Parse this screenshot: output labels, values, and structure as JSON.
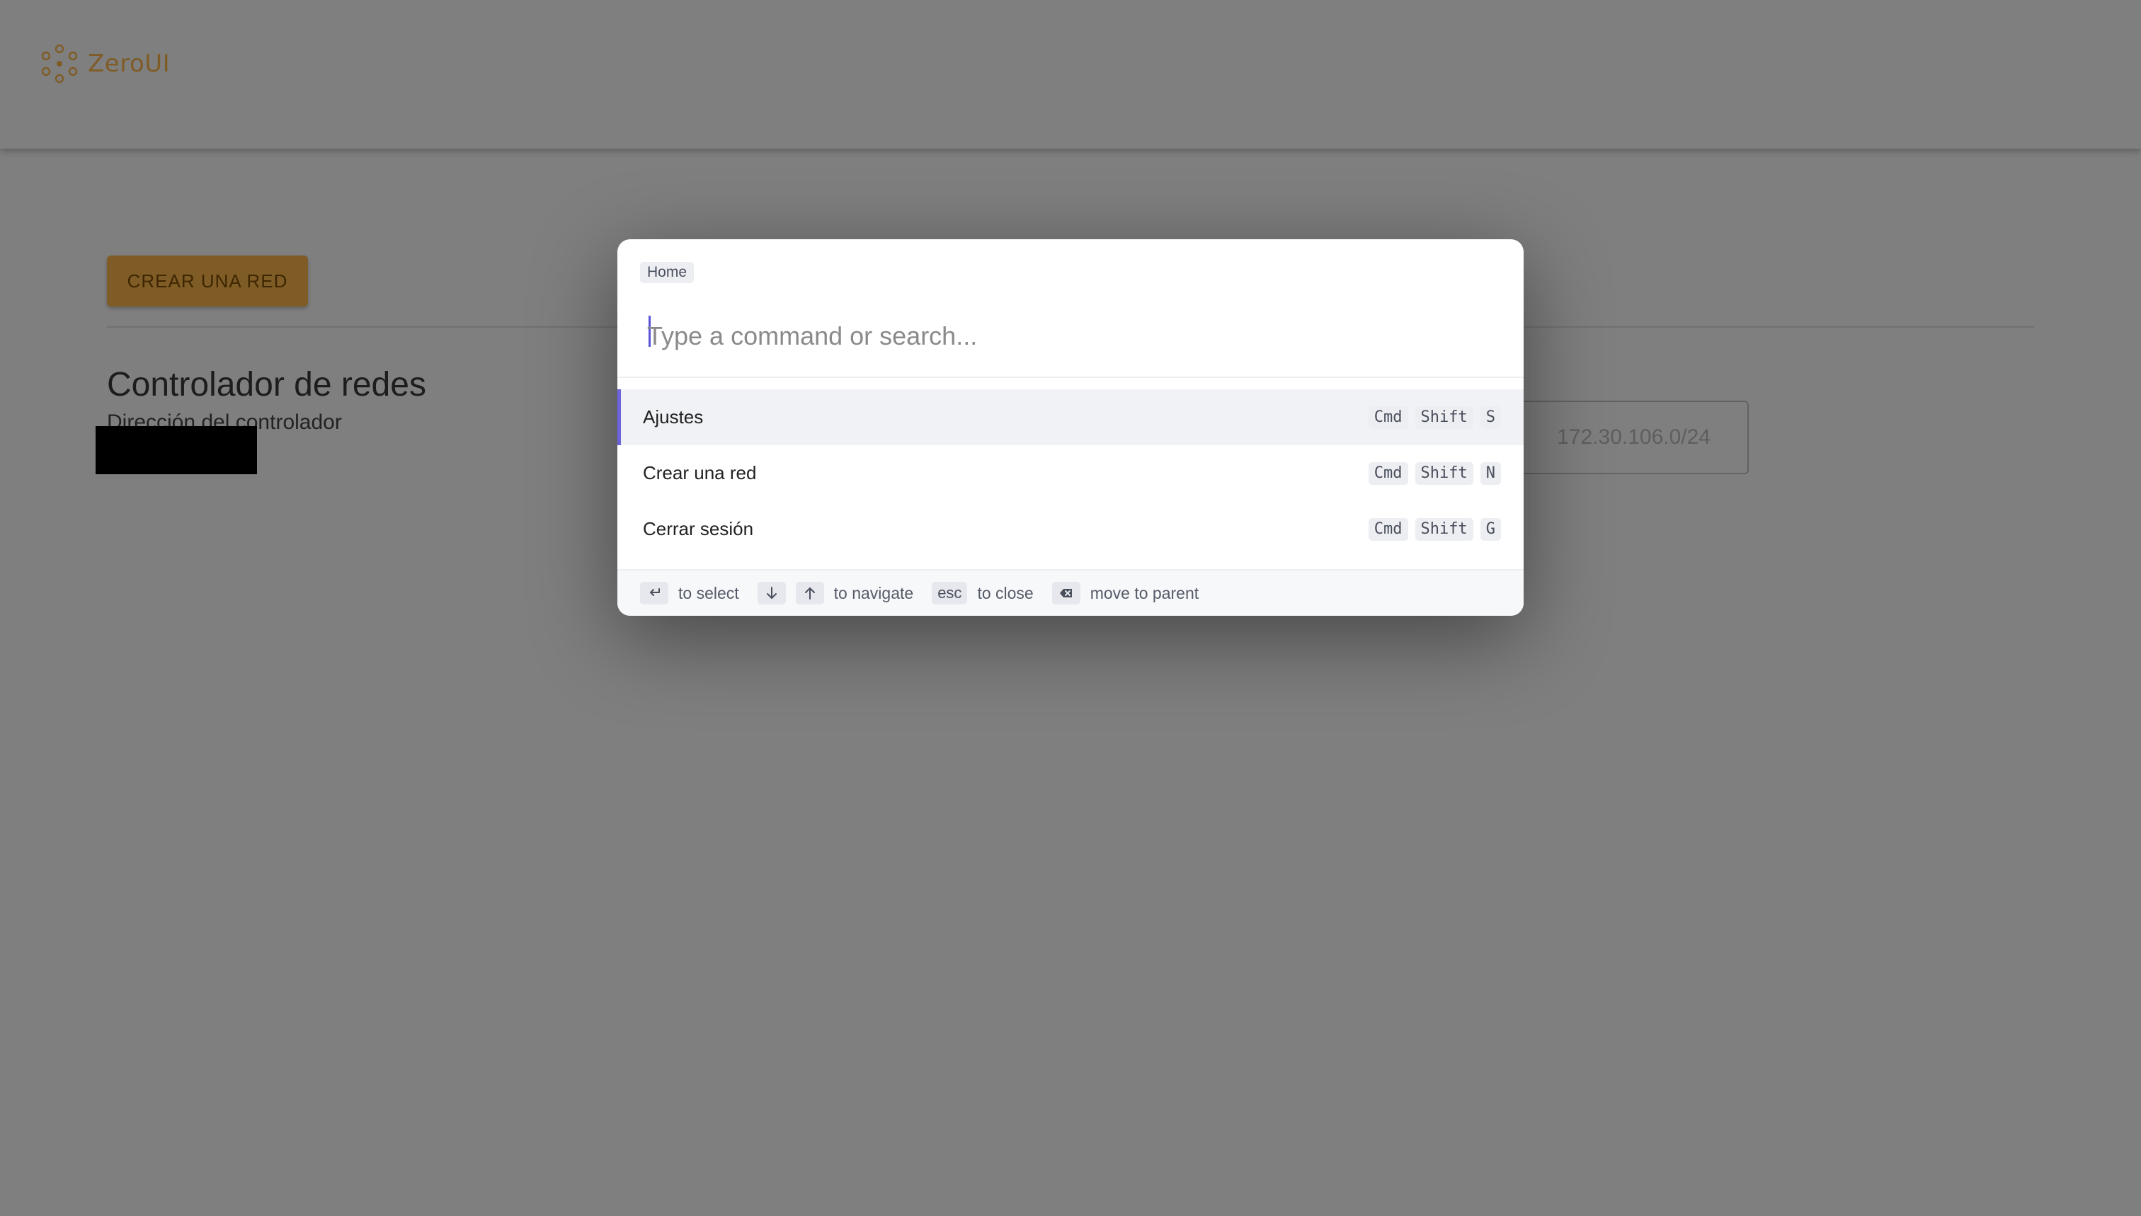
{
  "header": {
    "logo_text": "ZeroUI",
    "logo_color": "#ffb84d",
    "menu_icon": "hamburger-menu-icon"
  },
  "main": {
    "create_network_label": "CREAR UNA RED",
    "section_title": "Controlador de redes",
    "section_subtitle": "Dirección del controlador",
    "cidr_placeholder": "172.30.106.0/24"
  },
  "palette": {
    "breadcrumb": "Home",
    "search_placeholder": "Type a command or search...",
    "commands": [
      {
        "label": "Ajustes",
        "keys": [
          "Cmd",
          "Shift",
          "S"
        ],
        "active": true
      },
      {
        "label": "Crear una red",
        "keys": [
          "Cmd",
          "Shift",
          "N"
        ],
        "active": false
      },
      {
        "label": "Cerrar sesión",
        "keys": [
          "Cmd",
          "Shift",
          "G"
        ],
        "active": false
      }
    ],
    "footer": {
      "select_text": "to select",
      "navigate_text": "to navigate",
      "esc_key": "esc",
      "close_text": "to close",
      "parent_text": "move to parent"
    },
    "accent_color": "#6c63dd"
  }
}
